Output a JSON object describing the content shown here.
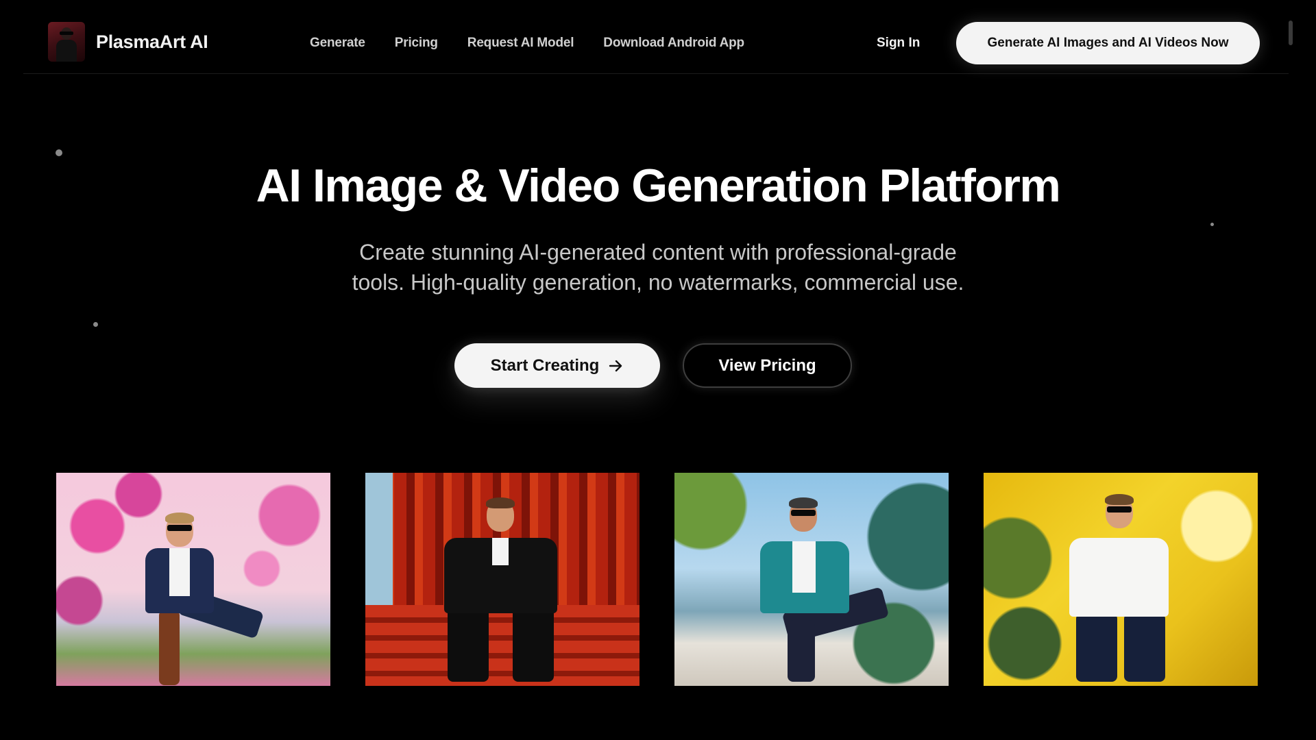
{
  "header": {
    "brand_name": "PlasmaArt AI",
    "nav": [
      "Generate",
      "Pricing",
      "Request AI Model",
      "Download Android App"
    ],
    "sign_in": "Sign In",
    "cta": "Generate AI Images and AI Videos Now"
  },
  "hero": {
    "title": "AI Image & Video Generation Platform",
    "subtitle_line1": "Create stunning AI-generated content with professional-grade",
    "subtitle_line2": "tools. High-quality generation, no watermarks, commercial use.",
    "primary_button": "Start Creating",
    "secondary_button": "View Pricing"
  },
  "gallery": {
    "items": [
      {
        "theme": "pink-blossom-portrait"
      },
      {
        "theme": "red-curtain-portrait"
      },
      {
        "theme": "blue-garden-portrait"
      },
      {
        "theme": "yellow-abstract-portrait"
      }
    ]
  },
  "colors": {
    "background": "#000000",
    "button_light": "#f3f3f3",
    "text_primary": "#ffffff",
    "text_secondary": "#c8c8c8"
  },
  "icons": {
    "primary_button_icon": "arrow-right-icon",
    "brand_logo": "brand-logo-icon"
  }
}
